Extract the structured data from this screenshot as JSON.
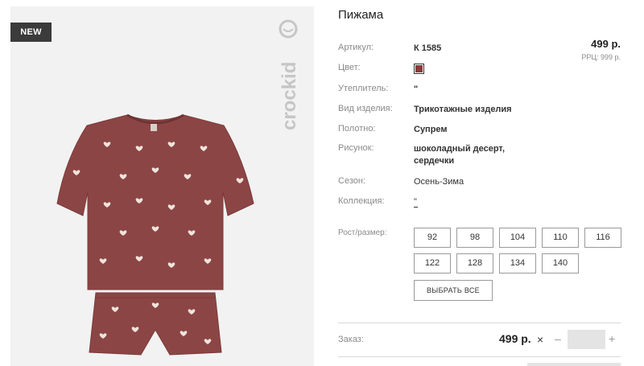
{
  "product": {
    "badge": "NEW",
    "brand": "crockid",
    "title": "Пижама",
    "price": "499 р.",
    "rrp": "РРЦ: 999 р.",
    "color_hex": "#8b3a3a"
  },
  "details": {
    "article_label": "Артикул:",
    "article_value": "К 1585",
    "color_label": "Цвет:",
    "insulation_label": "Утеплитель:",
    "insulation_value": "\"",
    "type_label": "Вид изделия:",
    "type_value": "Трикотажные изделия",
    "fabric_label": "Полотно:",
    "fabric_value": "Супрем",
    "pattern_label": "Рисунок:",
    "pattern_value": "шоколадный десерт, сердечки",
    "season_label": "Сезон:",
    "season_value": "Осень-Зима",
    "collection_label": "Коллекция:",
    "collection_value": "\""
  },
  "sizes": {
    "label": "Рост/размер:",
    "options": [
      "92",
      "98",
      "104",
      "110",
      "116",
      "122",
      "128",
      "134",
      "140"
    ],
    "select_all": "ВЫБРАТЬ ВСЕ"
  },
  "order": {
    "label": "Заказ:",
    "price": "499 р.",
    "times": "×",
    "minus": "–",
    "plus": "+",
    "quantity": ""
  }
}
